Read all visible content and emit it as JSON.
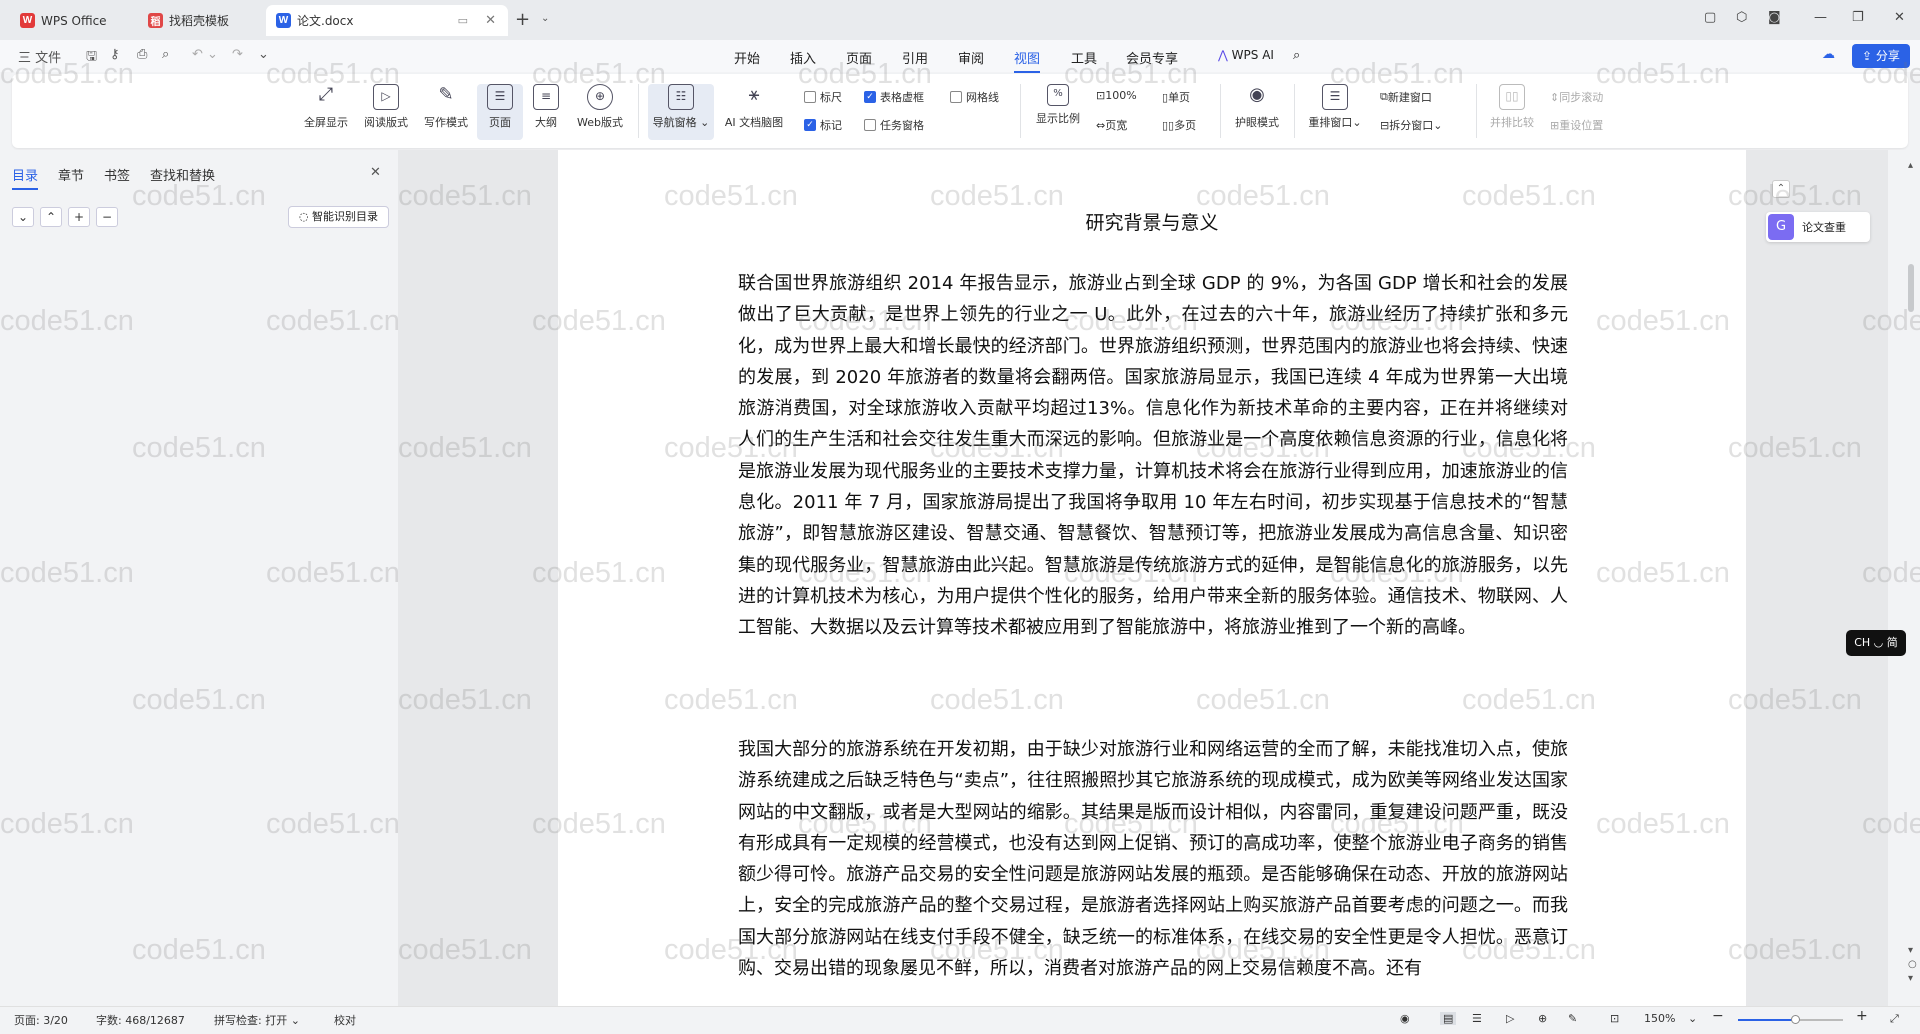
{
  "tabs": [
    {
      "label": "WPS Office",
      "icon": "W"
    },
    {
      "label": "找稻壳模板",
      "icon": "稻"
    },
    {
      "label": "论文.docx",
      "icon": "W"
    }
  ],
  "menu": {
    "file": "三 文件",
    "items": [
      "开始",
      "插入",
      "页面",
      "引用",
      "审阅",
      "视图",
      "工具",
      "会员专享"
    ],
    "active": "视图",
    "wps_ai": "WPS AI",
    "share": "分享"
  },
  "ribbon": {
    "fullscreen": "全屏显示",
    "read_mode": "阅读版式",
    "write_mode": "写作模式",
    "page": "页面",
    "outline": "大纲",
    "web_layout": "Web版式",
    "nav_pane": "导航窗格",
    "ai_mindmap": "AI 文档脑图",
    "ruler": "标尺",
    "table_gridlines": "表格虚框",
    "gridlines": "网格线",
    "marks": "标记",
    "task_pane": "任务窗格",
    "zoom_ratio": "显示比例",
    "zoom_100": "100%",
    "page_width": "页宽",
    "single_page": "单页",
    "multi_page": "多页",
    "eye_care": "护眼模式",
    "rearrange": "重排窗口",
    "new_window": "新建窗口",
    "split_window": "拆分窗口",
    "side_by_side": "并排比较",
    "sync_scroll": "同步滚动",
    "reset_position": "重设位置"
  },
  "nav": {
    "tabs": [
      "目录",
      "章节",
      "书签",
      "查找和替换"
    ],
    "smart_toc": "智能识别目录"
  },
  "document": {
    "title": "研究背景与意义",
    "para1": "联合国世界旅游组织 2014 年报告显示，旅游业占到全球 GDP 的 9%，为各国 GDP 增长和社会的发展做出了巨大贡献，是世界上领先的行业之一 U。此外，在过去的六十年，旅游业经历了持续扩张和多元化，成为世界上最大和增长最快的经济部门。世界旅游组织预测，世界范围内的旅游业也将会持续、快速的发展，到 2020 年旅游者的数量将会翻两倍。国家旅游局显示，我国已连续 4 年成为世界第一大出境旅游消费国，对全球旅游收入贡献平均超过13%。信息化作为新技术革命的主要内容，正在并将继续对人们的生产生活和社会交往发生重大而深远的影响。但旅游业是一个高度依赖信息资源的行业，信息化将是旅游业发展为现代服务业的主要技术支撑力量，计算机技术将会在旅游行业得到应用，加速旅游业的信息化。2011 年 7 月，国家旅游局提出了我国将争取用 10 年左右时间，初步实现基于信息技术的“智慧旅游”，即智慧旅游区建设、智慧交通、智慧餐饮、智慧预订等，把旅游业发展成为高信息含量、知识密集的现代服务业，智慧旅游由此兴起。智慧旅游是传统旅游方式的延伸，是智能信息化的旅游服务，以先进的计算机技术为核心，为用户提供个性化的服务，给用户带来全新的服务体验。通信技术、物联网、人工智能、大数据以及云计算等技术都被应用到了智能旅游中，将旅游业推到了一个新的高峰。",
    "para2": "我国大部分的旅游系统在开发初期，由于缺少对旅游行业和网络运营的全而了解，未能找准切入点，使旅游系统建成之后缺乏特色与“卖点”，往往照搬照抄其它旅游系统的现成模式，成为欧美等网络业发达国家网站的中文翻版，或者是大型网站的缩影。其结果是版而设计相似，内容雷同，重复建设问题严重，既没有形成具有一定规模的经营模式，也没有达到网上促销、预订的高成功率，使整个旅游业电子商务的销售额少得可怜。旅游产品交易的安全性问题是旅游网站发展的瓶颈。是否能够确保在动态、开放的旅游网站上，安全的完成旅游产品的整个交易过程，是旅游者选择网站上购买旅游产品首要考虑的问题之一。而我国大部分旅游网站在线支付手段不健全，缺乏统一的标准体系，在线交易的安全性更是令人担忧。恶意订购、交易出错的现象屡见不鲜，所以，消费者对旅游产品的网上交易信赖度不高。还有"
  },
  "side": {
    "check": "论文查重",
    "ime": "CH ◡ 简"
  },
  "status": {
    "page": "页面: 3/20",
    "words": "字数: 468/12687",
    "spell": "拼写检查: 打开 ⌄",
    "proof": "校对",
    "zoom": "150%"
  },
  "watermark": "code51.cn"
}
